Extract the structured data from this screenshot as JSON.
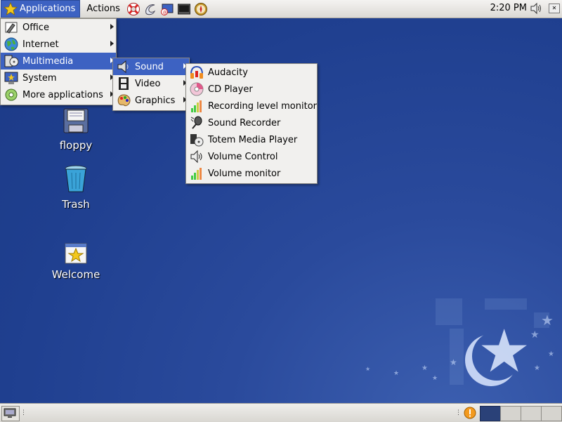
{
  "top_panel": {
    "menus": [
      "Applications",
      "Actions"
    ],
    "launchers": [
      "help-lifebuoy-icon",
      "web-browser-icon",
      "email-icon",
      "terminal-icon",
      "compass-icon"
    ],
    "clock": "2:20 PM"
  },
  "applications_menu": {
    "items": [
      {
        "label": "Office",
        "icon": "office-icon",
        "submenu": true
      },
      {
        "label": "Internet",
        "icon": "internet-globe-icon",
        "submenu": true
      },
      {
        "label": "Multimedia",
        "icon": "multimedia-icon",
        "submenu": true,
        "highlighted": true
      },
      {
        "label": "System",
        "icon": "system-icon",
        "submenu": true
      },
      {
        "label": "More applications",
        "icon": "more-applications-icon",
        "submenu": true
      }
    ]
  },
  "multimedia_menu": {
    "items": [
      {
        "label": "Sound",
        "icon": "speaker-icon",
        "highlighted": true
      },
      {
        "label": "Video",
        "icon": "film-icon"
      },
      {
        "label": "Graphics",
        "icon": "palette-icon"
      }
    ]
  },
  "sound_menu": {
    "items": [
      {
        "label": "Audacity",
        "icon": "audacity-headphones-icon"
      },
      {
        "label": "CD Player",
        "icon": "cd-icon"
      },
      {
        "label": "Recording level monitor",
        "icon": "level-meter-icon"
      },
      {
        "label": "Sound Recorder",
        "icon": "microphone-icon"
      },
      {
        "label": "Totem Media Player",
        "icon": "film-reel-icon"
      },
      {
        "label": "Volume Control",
        "icon": "speaker-volume-icon"
      },
      {
        "label": "Volume monitor",
        "icon": "level-meter-icon"
      }
    ]
  },
  "desktop_icons": [
    {
      "label": "floppy",
      "icon": "floppy-icon"
    },
    {
      "label": "Trash",
      "icon": "trash-icon"
    },
    {
      "label": "Welcome",
      "icon": "welcome-star-icon"
    }
  ],
  "colors": {
    "highlight": "#3d62c2",
    "desktop": "#1f3f8f",
    "panel": "#e6e4df"
  }
}
